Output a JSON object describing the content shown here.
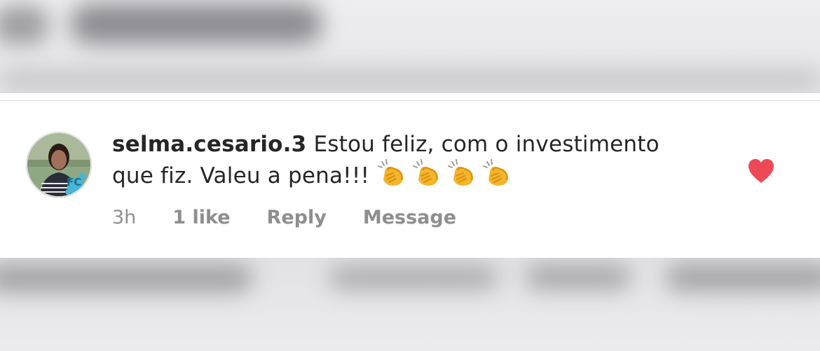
{
  "comment": {
    "username": "selma.cesario.3",
    "text_line1": "Estou feliz, com o investimento",
    "text_line2": "que fiz. Valeu a pena!!!",
    "emoji": "clapping-hands",
    "emoji_count": 4,
    "time": "3h",
    "likes_label": "1 like",
    "reply_label": "Reply",
    "message_label": "Message",
    "liked": true,
    "avatar_badge": "FC"
  },
  "colors": {
    "text": "#262626",
    "meta": "#8e8e8e",
    "heart": "#ed4956",
    "card": "#ffffff"
  }
}
